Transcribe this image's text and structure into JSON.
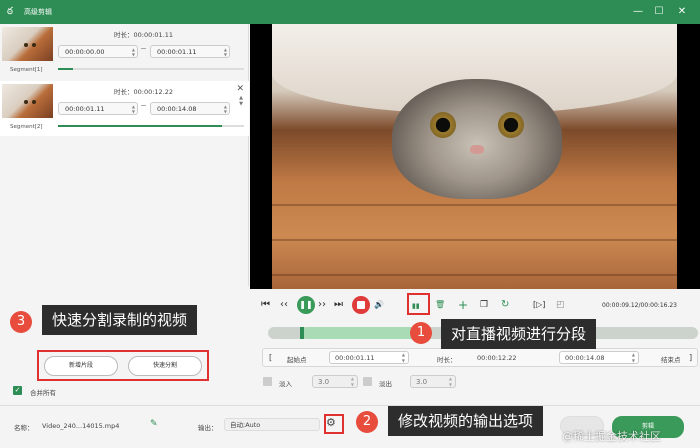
{
  "window": {
    "title": "高级剪辑",
    "minimize": "—",
    "maximize": "☐",
    "close": "✕",
    "logo": "ఠ"
  },
  "segments": [
    {
      "name": "Segment[1]",
      "duration_label": "时长：",
      "duration": "00:00:01.11",
      "start": "00:00:00.00",
      "end": "00:00:01.11",
      "progress_pct": 8
    },
    {
      "name": "Segment[2]",
      "duration_label": "时长：",
      "duration": "00:00:12.22",
      "start": "00:00:01.11",
      "end": "00:00:14.08",
      "progress_pct": 88
    }
  ],
  "player": {
    "timecode": "00:00:09.12/00:00:16.23",
    "icons": [
      "skip-start-icon",
      "prev-frame-icon",
      "play-pause-icon",
      "next-frame-icon",
      "skip-end-icon",
      "volume-icon",
      "stop-icon",
      "split-icon",
      "delete-icon",
      "add-icon",
      "copy-icon",
      "rotate-icon",
      "bracket-in-icon",
      "snapshot-icon"
    ],
    "glyphs": {
      "skip_start": "⏮",
      "prev": "‹‹",
      "play": "❚❚",
      "next": "››",
      "skip_end": "⏭",
      "volume": "🔊",
      "split": "▮▮",
      "delete": "🗑",
      "add": "+",
      "copy": "❐",
      "rotate": "↻",
      "bracket": "[▷]",
      "snap": "◰"
    }
  },
  "range": {
    "start_label": "起始点",
    "start_value": "00:00:01.11",
    "duration_label": "时长：",
    "duration_value": "00:00:12.22",
    "end_value": "00:00:14.08",
    "end_label": "结束点",
    "bracket_open": "[",
    "bracket_close": "]"
  },
  "fade": {
    "fade_in_label": "淡入",
    "fade_in_value": "3.0",
    "fade_out_label": "淡出",
    "fade_out_value": "3.0"
  },
  "left_actions": {
    "new_segment": "新增片段",
    "quick_split": "快速分割",
    "merge_all": "合并所有"
  },
  "bottom": {
    "name_label": "名称：",
    "name_value": "Video_240...14015.mp4",
    "output_label": "输出：",
    "output_value": "自动;Auto",
    "cut_button": "剪辑"
  },
  "annotations": {
    "callout1": {
      "num": "1",
      "text": "对直播视频进行分段"
    },
    "callout2": {
      "num": "2",
      "text": "修改视频的输出选项"
    },
    "callout3": {
      "num": "3",
      "text": "快速分割录制的视频"
    },
    "watermark": "@稀土掘金技术社区"
  },
  "colors": {
    "brand": "#2e8d54",
    "accent_red": "#e03b3b",
    "callout_bg": "#2d2d2d"
  }
}
